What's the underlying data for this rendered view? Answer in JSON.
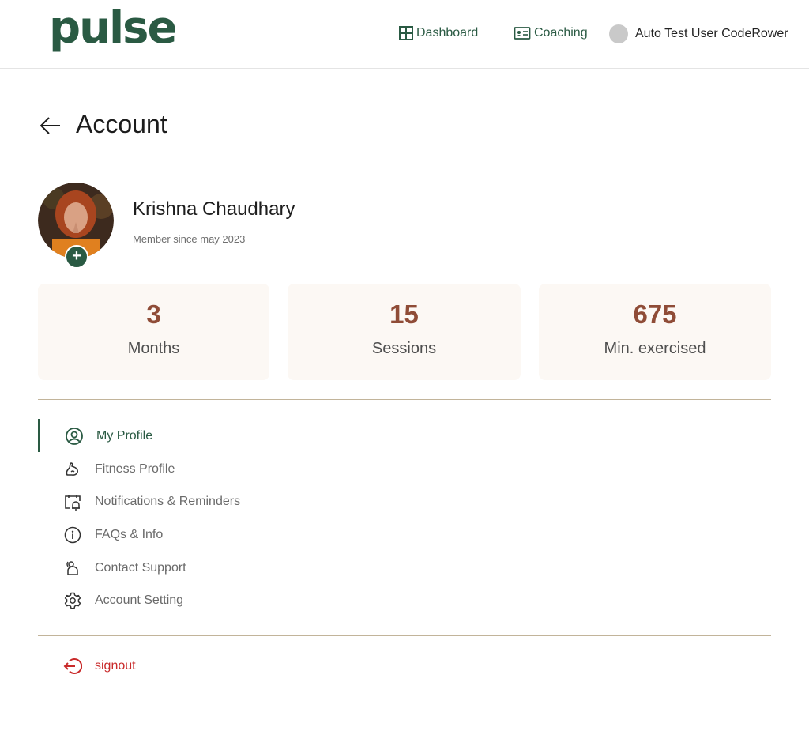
{
  "header": {
    "logo": "pulse",
    "nav": {
      "dashboard": "Dashboard",
      "coaching": "Coaching"
    },
    "user_name": "Auto Test User CodeRower"
  },
  "page": {
    "title": "Account"
  },
  "profile": {
    "name": "Krishna Chaudhary",
    "member_since": "Member since may 2023",
    "add_photo_symbol": "+"
  },
  "stats": [
    {
      "value": "3",
      "label": "Months"
    },
    {
      "value": "15",
      "label": "Sessions"
    },
    {
      "value": "675",
      "label": "Min. exercised"
    }
  ],
  "menu": [
    {
      "label": "My Profile",
      "icon": "user-circle-icon",
      "active": true
    },
    {
      "label": "Fitness Profile",
      "icon": "flex-arm-icon",
      "active": false
    },
    {
      "label": "Notifications & Reminders",
      "icon": "calendar-bell-icon",
      "active": false
    },
    {
      "label": "FAQs & Info",
      "icon": "info-icon",
      "active": false
    },
    {
      "label": "Contact Support",
      "icon": "support-icon",
      "active": false
    },
    {
      "label": "Account Setting",
      "icon": "gear-icon",
      "active": false
    }
  ],
  "signout": {
    "label": "signout",
    "icon": "signout-icon"
  },
  "colors": {
    "brand_green": "#2a5a43",
    "stat_value": "#8f4c37",
    "stat_bg": "#fcf8f4",
    "divider": "#c2b49a",
    "signout_red": "#c92a2a"
  }
}
